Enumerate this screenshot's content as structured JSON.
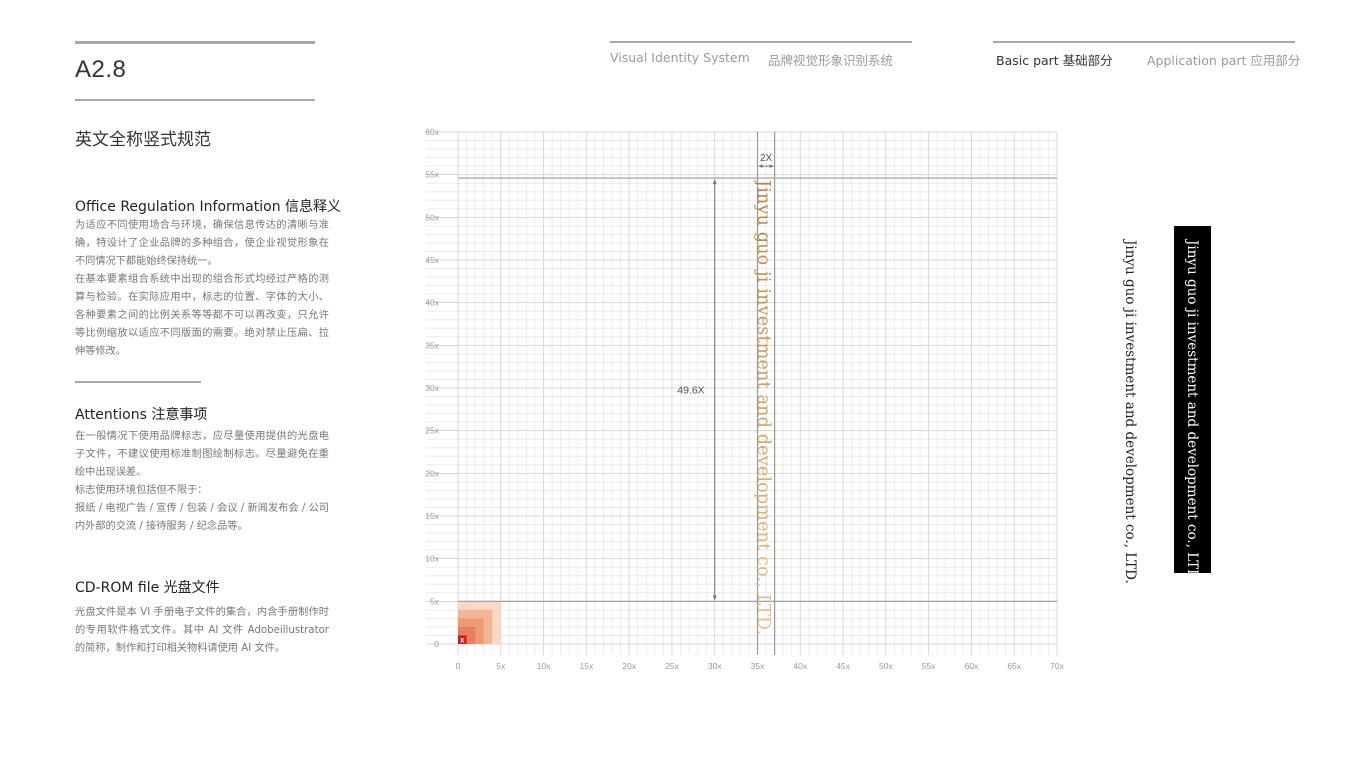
{
  "page": {
    "code": "A2.8",
    "title": "英文全称竖式规范"
  },
  "nav": {
    "vis_en": "Visual Identity System",
    "vis_cn": "品牌视觉形象识别系统",
    "basic": "Basic part  基础部分",
    "application": "Application part  应用部分",
    "active": "basic"
  },
  "sections": [
    {
      "title": "Office Regulation Information 信息释义",
      "paragraphs": [
        "为适应不同使用场合与环境，确保信息传达的清晰与准确，特设计了企业品牌的多种组合，使企业视觉形象在不同情况下都能始终保持统一。",
        "在基本要素组合系统中出现的组合形式均经过严格的测算与检验。在实际应用中，标志的位置、字体的大小、各种要素之间的比例关系等等都不可以再改变，只允许等比例缩放以适应不同版面的需要。绝对禁止压扁、拉伸等修改。"
      ]
    },
    {
      "title": "Attentions 注意事项",
      "paragraphs": [
        "在一般情况下使用品牌标志，应尽量使用提供的光盘电子文件，不建议使用标准制图绘制标志。尽量避免在重绘中出现误差。",
        "标志使用环境包括但不限于：",
        "报纸 / 电视广告 / 宣传 / 包装 / 会议 / 新闻发布会 / 公司内外部的交流 / 接待服务 / 纪念品等。"
      ]
    },
    {
      "title": "CD-ROM file 光盘文件",
      "paragraphs": [
        "光盘文件是本 VI 手册电子文件的集合，内含手册制作时的专用软件格式文件。其中 AI 文件 Adobeillustrator 的简称，制作和打印相关物料请使用 AI 文件。"
      ]
    }
  ],
  "logo_text": "Jinyu guo ji investment and development co., LTD.",
  "chart_data": {
    "type": "grid",
    "title": "",
    "x_ticks": [
      "0",
      "5x",
      "10x",
      "15x",
      "20x",
      "25x",
      "30x",
      "35x",
      "40x",
      "45x",
      "50x",
      "55x",
      "60x",
      "65x",
      "70x"
    ],
    "y_ticks": [
      "0",
      "5x",
      "10x",
      "15x",
      "20x",
      "25x",
      "30x",
      "35x",
      "40x",
      "45x",
      "50x",
      "55x",
      "60x"
    ],
    "xlim": [
      0,
      70
    ],
    "ylim": [
      0,
      60
    ],
    "minor_step": 1,
    "major_step": 5,
    "unit_label": "x",
    "guides": {
      "baseline_y": 5,
      "top_y": 54.6,
      "column_x": [
        35,
        37
      ]
    },
    "annotations": {
      "height_label": "49.6X",
      "height_x": 30,
      "width_label": "2X"
    },
    "unit_squares": [
      {
        "size": 5,
        "color": "#f9d8c6"
      },
      {
        "size": 4,
        "color": "#f3b596"
      },
      {
        "size": 3,
        "color": "#ee9a77"
      },
      {
        "size": 2,
        "color": "#ea7f5c"
      },
      {
        "size": 1,
        "color": "#e0111b",
        "label": "x"
      }
    ]
  }
}
